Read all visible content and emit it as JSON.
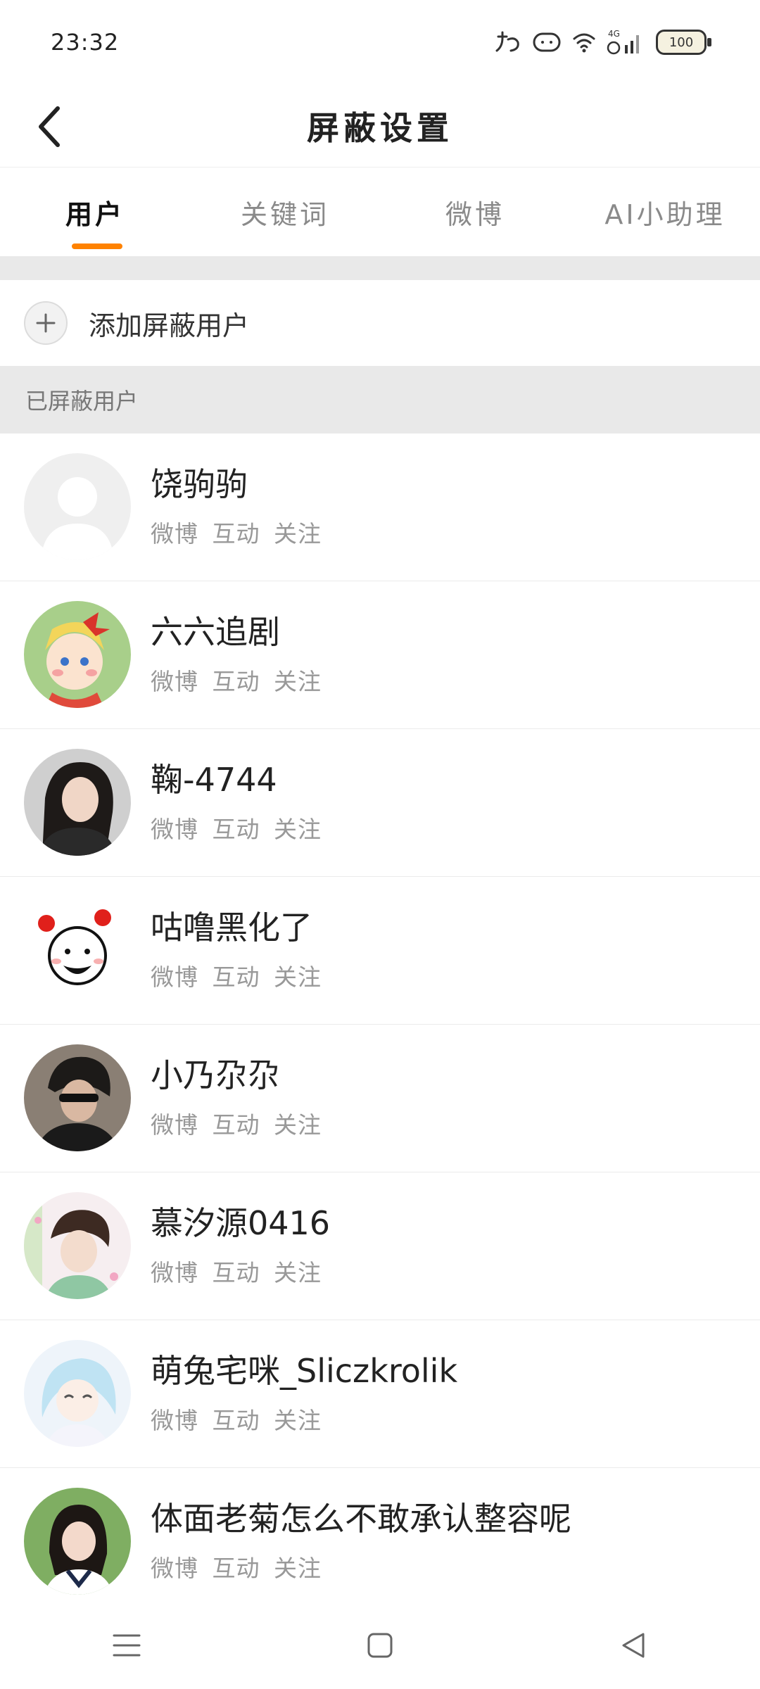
{
  "status_bar": {
    "time": "23:32",
    "network": "4G",
    "battery": "100",
    "icons": [
      "app-notification-icon",
      "cloud-face-icon",
      "wifi-icon",
      "signal-4g-icon",
      "battery-icon"
    ]
  },
  "header": {
    "title": "屏蔽设置",
    "back_icon": "back-arrow-icon"
  },
  "tabs": [
    {
      "label": "用户",
      "active": true
    },
    {
      "label": "关键词",
      "active": false
    },
    {
      "label": "微博",
      "active": false
    },
    {
      "label": "AI小助理",
      "active": false
    }
  ],
  "accent_color": "#ff8200",
  "add_user": {
    "label": "添加屏蔽用户",
    "icon": "plus-icon"
  },
  "section": {
    "title": "已屏蔽用户"
  },
  "blocked_users": [
    {
      "name": "饶驹驹",
      "meta": [
        "微博",
        "互动",
        "关注"
      ]
    },
    {
      "name": "六六追剧",
      "meta": [
        "微博",
        "互动",
        "关注"
      ]
    },
    {
      "name": "鞠-4744",
      "meta": [
        "微博",
        "互动",
        "关注"
      ]
    },
    {
      "name": "咕噜黑化了",
      "meta": [
        "微博",
        "互动",
        "关注"
      ]
    },
    {
      "name": "小乃尕尕",
      "meta": [
        "微博",
        "互动",
        "关注"
      ]
    },
    {
      "name": "慕汐源0416",
      "meta": [
        "微博",
        "互动",
        "关注"
      ]
    },
    {
      "name": "萌兔宅咪_Sliczkrolik",
      "meta": [
        "微博",
        "互动",
        "关注"
      ]
    },
    {
      "name": "体面老菊怎么不敢承认整容呢",
      "meta": [
        "微博",
        "互动",
        "关注"
      ]
    }
  ],
  "system_nav": [
    "menu-icon",
    "home-square-icon",
    "back-triangle-icon"
  ]
}
